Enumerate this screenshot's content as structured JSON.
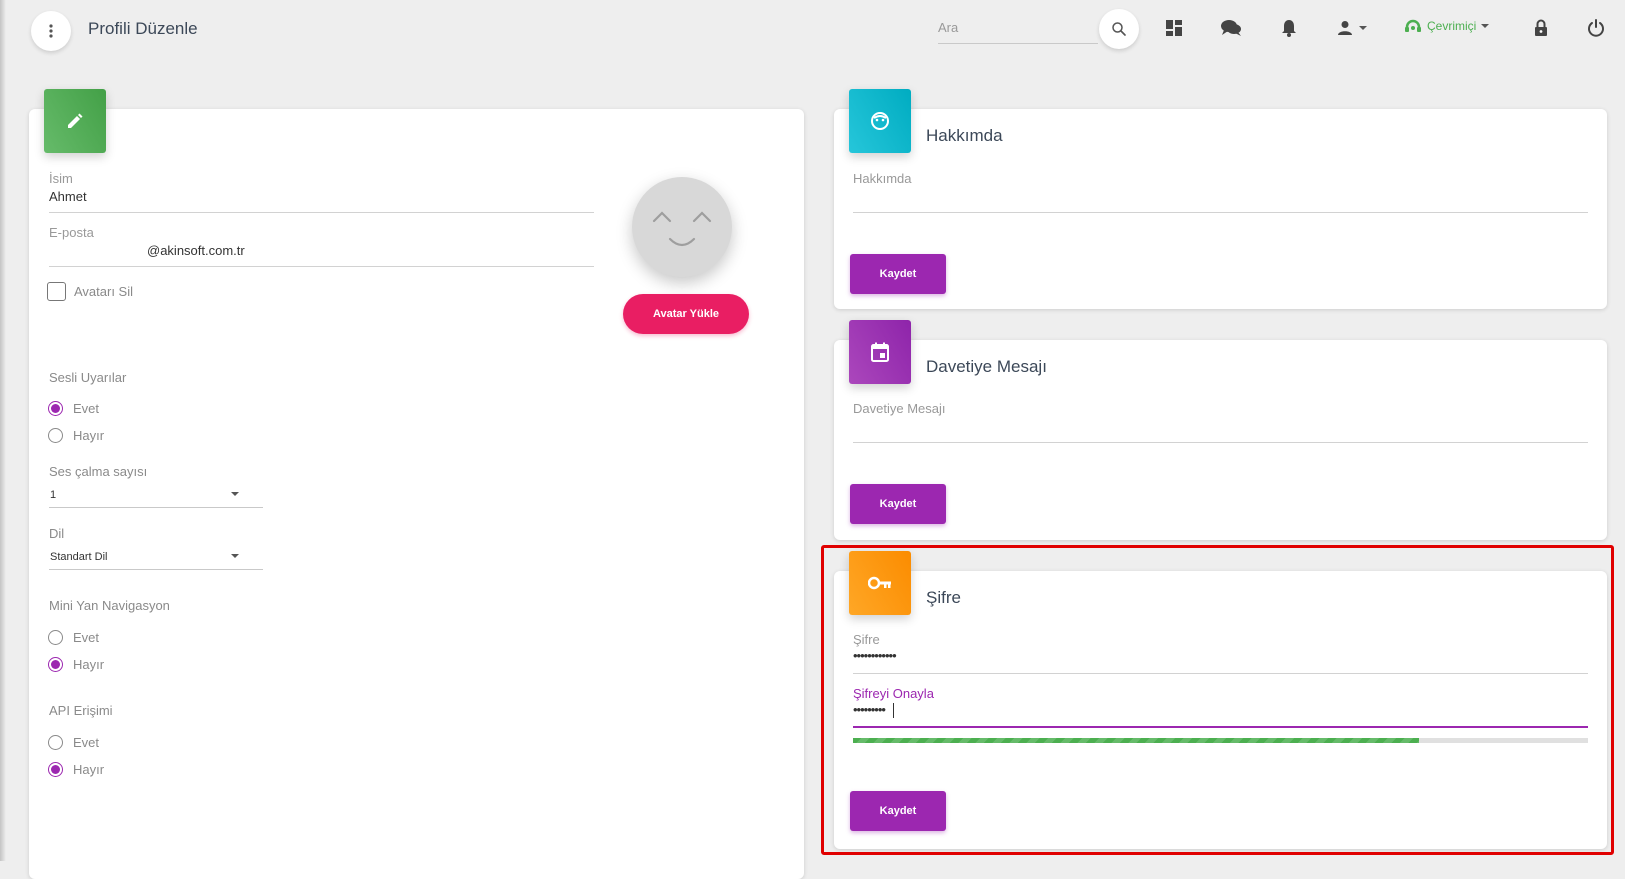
{
  "header": {
    "title": "Profili Düzenle",
    "search_placeholder": "Ara",
    "status_label": "Çevrimiçi"
  },
  "profile": {
    "name_label": "İsim",
    "name_value": "Ahmet",
    "email_label": "E-posta",
    "email_value": "@akinsoft.com.tr",
    "remove_avatar_label": "Avatarı Sil",
    "upload_avatar_label": "Avatar Yükle",
    "sound_alerts": {
      "label": "Sesli Uyarılar",
      "options": [
        "Evet",
        "Hayır"
      ],
      "selected": "Evet"
    },
    "sound_count": {
      "label": "Ses çalma sayısı",
      "value": "1"
    },
    "language": {
      "label": "Dil",
      "value": "Standart Dil"
    },
    "mini_nav": {
      "label": "Mini Yan Navigasyon",
      "options": [
        "Evet",
        "Hayır"
      ],
      "selected": "Hayır"
    },
    "api_access": {
      "label": "API Erişimi",
      "options": [
        "Evet",
        "Hayır"
      ],
      "selected": "Hayır"
    }
  },
  "about": {
    "title": "Hakkımda",
    "field_label": "Hakkımda",
    "save_label": "Kaydet"
  },
  "invite": {
    "title": "Davetiye Mesajı",
    "field_label": "Davetiye Mesajı",
    "save_label": "Kaydet"
  },
  "password": {
    "title": "Şifre",
    "password_label": "Şifre",
    "password_value": "••••••••••••",
    "confirm_label": "Şifreyi Onayla",
    "confirm_value": "•••••••••",
    "strength_percent": 77,
    "save_label": "Kaydet"
  },
  "colors": {
    "accent": "#9c27b0",
    "pink": "#e91e63",
    "highlight": "#e00000",
    "online": "#4caf50"
  }
}
